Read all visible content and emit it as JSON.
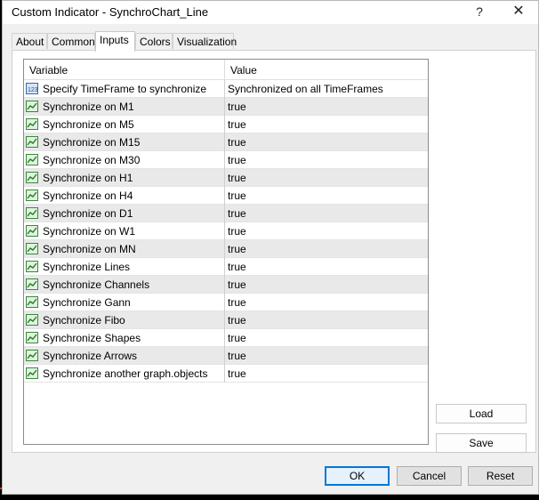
{
  "window": {
    "title": "Custom Indicator - SynchroChart_Line",
    "help_glyph": "?",
    "close_glyph": "✕"
  },
  "tabs": [
    {
      "label": "About"
    },
    {
      "label": "Common"
    },
    {
      "label": "Inputs"
    },
    {
      "label": "Colors"
    },
    {
      "label": "Visualization"
    }
  ],
  "table": {
    "columns": {
      "variable": "Variable",
      "value": "Value"
    },
    "rows": [
      {
        "icon": "number-icon",
        "variable": "Specify TimeFrame to synchronize",
        "value": "Synchronized on all TimeFrames"
      },
      {
        "icon": "bool-icon",
        "variable": "Synchronize on M1",
        "value": "true"
      },
      {
        "icon": "bool-icon",
        "variable": "Synchronize on M5",
        "value": "true"
      },
      {
        "icon": "bool-icon",
        "variable": "Synchronize on M15",
        "value": "true"
      },
      {
        "icon": "bool-icon",
        "variable": "Synchronize on M30",
        "value": "true"
      },
      {
        "icon": "bool-icon",
        "variable": "Synchronize on H1",
        "value": "true"
      },
      {
        "icon": "bool-icon",
        "variable": "Synchronize on H4",
        "value": "true"
      },
      {
        "icon": "bool-icon",
        "variable": "Synchronize on D1",
        "value": "true"
      },
      {
        "icon": "bool-icon",
        "variable": "Synchronize on W1",
        "value": "true"
      },
      {
        "icon": "bool-icon",
        "variable": "Synchronize on MN",
        "value": "true"
      },
      {
        "icon": "bool-icon",
        "variable": "Synchronize Lines",
        "value": "true"
      },
      {
        "icon": "bool-icon",
        "variable": "Synchronize Channels",
        "value": "true"
      },
      {
        "icon": "bool-icon",
        "variable": "Synchronize Gann",
        "value": "true"
      },
      {
        "icon": "bool-icon",
        "variable": "Synchronize Fibo",
        "value": "true"
      },
      {
        "icon": "bool-icon",
        "variable": "Synchronize Shapes",
        "value": "true"
      },
      {
        "icon": "bool-icon",
        "variable": "Synchronize Arrows",
        "value": "true"
      },
      {
        "icon": "bool-icon",
        "variable": "Synchronize another graph.objects",
        "value": "true"
      }
    ]
  },
  "side_buttons": {
    "load": "Load",
    "save": "Save"
  },
  "footer": {
    "ok": "OK",
    "cancel": "Cancel",
    "reset": "Reset"
  }
}
